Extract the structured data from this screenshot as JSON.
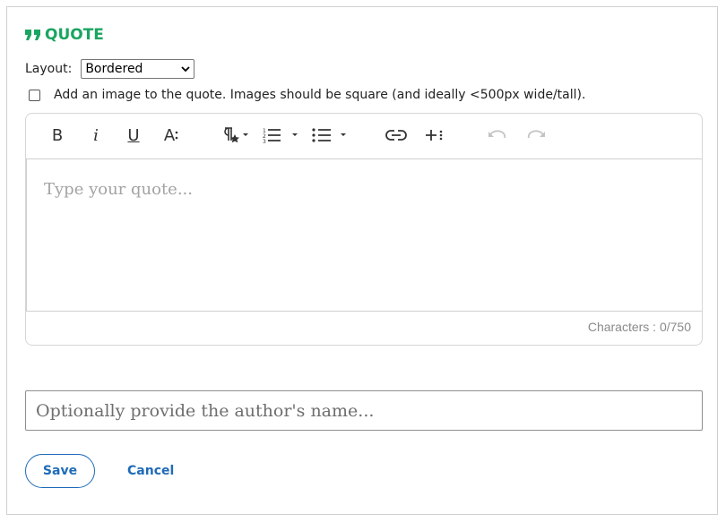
{
  "heading": {
    "title": "QUOTE",
    "color": "#1aa561"
  },
  "layout": {
    "label": "Layout:",
    "selected": "Bordered"
  },
  "image_option": {
    "label": "Add an image to the quote. Images should be square (and ideally <500px wide/tall).",
    "checked": false
  },
  "toolbar": {
    "items": [
      "bold-icon",
      "italic-icon",
      "underline-icon",
      "font-size-icon",
      "paragraph-format-icon",
      "ordered-list-icon",
      "unordered-list-icon",
      "link-icon",
      "more-icon",
      "undo-icon",
      "redo-icon"
    ],
    "bold_label": "B",
    "italic_label": "i",
    "underline_label": "U",
    "font_size_label": "A"
  },
  "editor": {
    "placeholder": "Type your quote...",
    "counter": "Characters : 0/750"
  },
  "author": {
    "placeholder": "Optionally provide the author's name..."
  },
  "actions": {
    "save_label": "Save",
    "cancel_label": "Cancel",
    "link_color": "#1f6bb8"
  }
}
